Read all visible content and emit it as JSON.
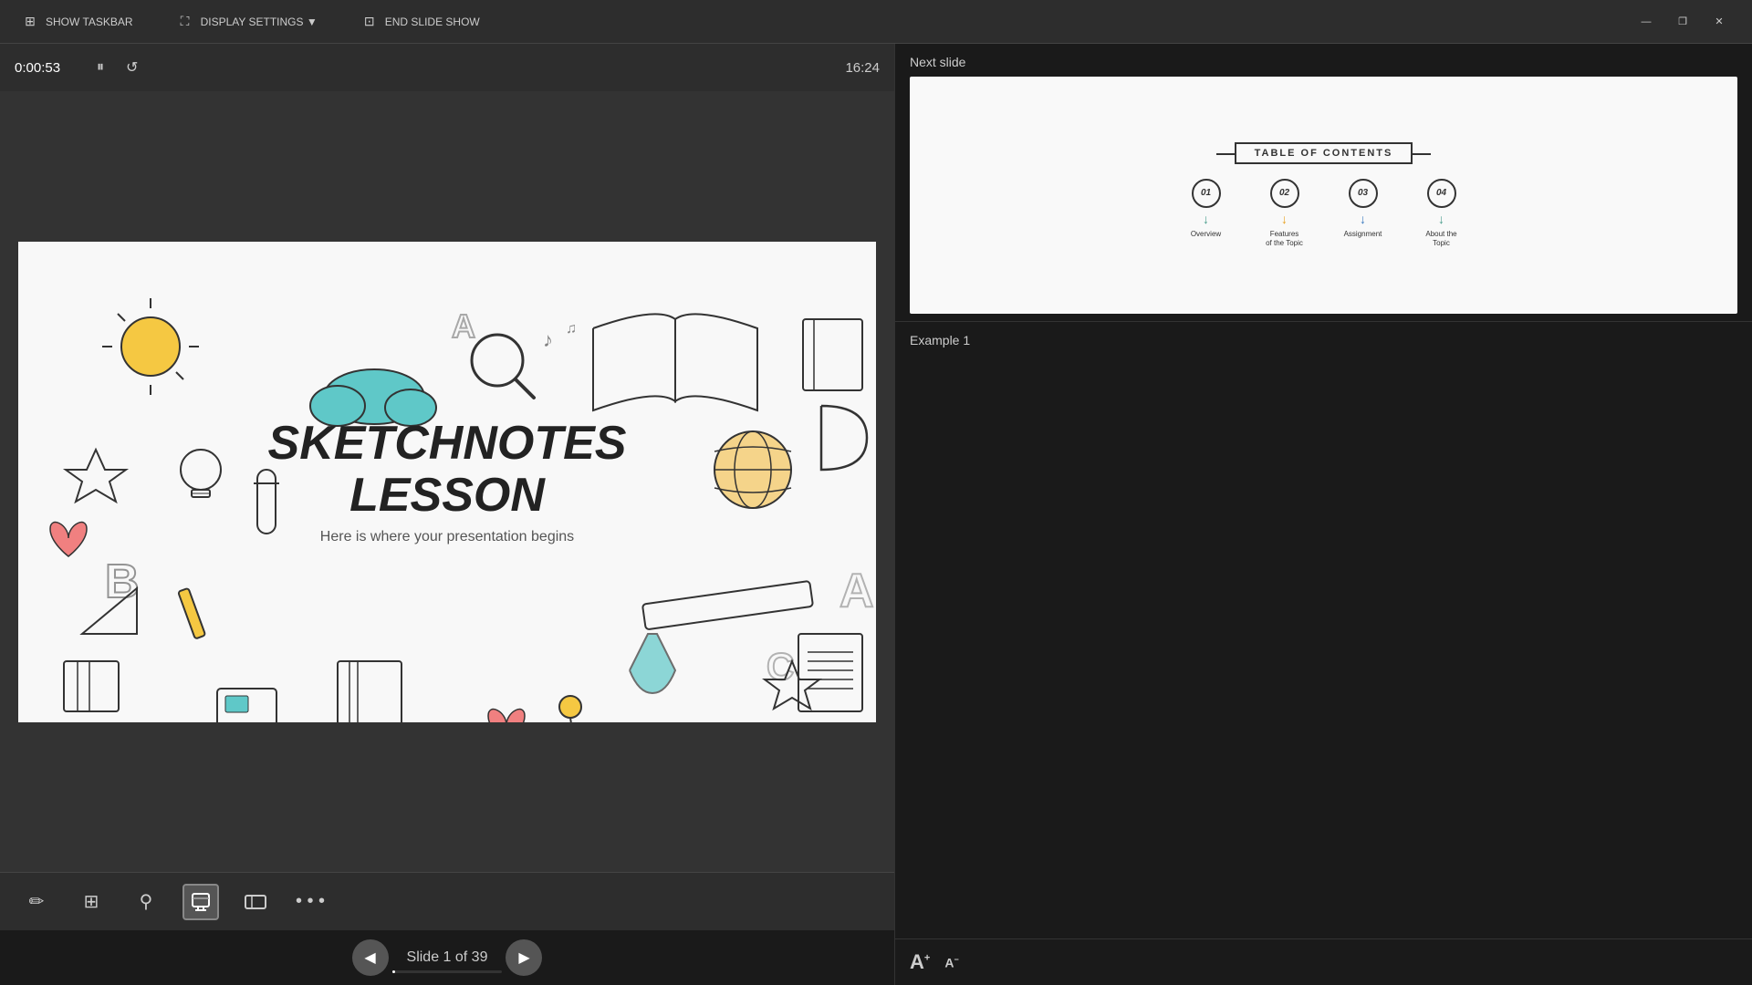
{
  "topbar": {
    "items": [
      {
        "id": "show-taskbar",
        "icon": "⊞",
        "label": "SHOW TASKBAR"
      },
      {
        "id": "display-settings",
        "icon": "⛶",
        "label": "DISPLAY SETTINGS ▼"
      },
      {
        "id": "end-slideshow",
        "icon": "⊡",
        "label": "END SLIDE SHOW"
      }
    ],
    "win_controls": {
      "minimize": "—",
      "restore": "❐",
      "close": "✕"
    }
  },
  "slide_controls": {
    "timer": "0:00:53",
    "time_right": "16:24"
  },
  "current_slide": {
    "title_line1": "SKETCHNOTES",
    "title_line2": "LESSON",
    "subtitle": "Here is where your presentation begins"
  },
  "slide_nav": {
    "prev_label": "◀",
    "next_label": "▶",
    "counter": "Slide 1 of 39",
    "current": 1,
    "total": 39
  },
  "toolbar": {
    "tools": [
      {
        "id": "pen",
        "icon": "✏",
        "active": false
      },
      {
        "id": "grid",
        "icon": "⊞",
        "active": false
      },
      {
        "id": "search",
        "icon": "⌕",
        "active": false
      },
      {
        "id": "pointer",
        "icon": "⌖",
        "active": true
      },
      {
        "id": "view",
        "icon": "▬",
        "active": false
      },
      {
        "id": "more",
        "icon": "•••",
        "active": false
      }
    ]
  },
  "right_panel": {
    "next_slide_label": "Next slide",
    "toc": {
      "title": "TABLE OF CONTENTS",
      "items": [
        {
          "number": "01",
          "label": "Overview",
          "arrow_color": "teal"
        },
        {
          "number": "02",
          "label": "Features\nof the Topic",
          "arrow_color": "yellow"
        },
        {
          "number": "03",
          "label": "Assignment",
          "arrow_color": "blue"
        },
        {
          "number": "04",
          "label": "About the\nTopic",
          "arrow_color": "teal"
        }
      ]
    },
    "example_label": "Example 1",
    "font_controls": {
      "increase": "A",
      "decrease": "A"
    }
  }
}
